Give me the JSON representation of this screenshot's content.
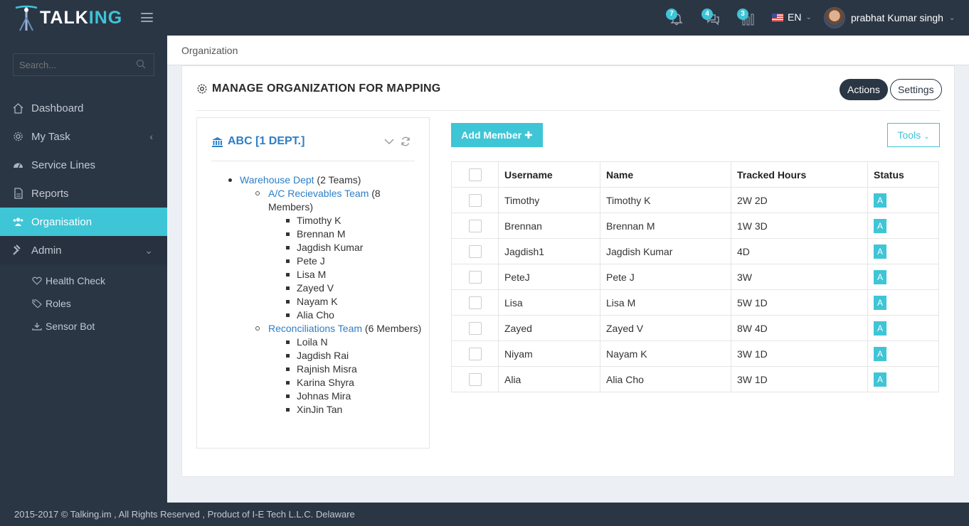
{
  "brand": {
    "logo_text_a": "TALK",
    "logo_text_b": "ING"
  },
  "topbar": {
    "notifications": {
      "count": "7",
      "icon": "bell-icon"
    },
    "messages": {
      "count": "4",
      "icon": "chat-icon"
    },
    "stats": {
      "count": "3",
      "icon": "bar-chart-icon"
    },
    "language": "EN",
    "user_name": "prabhat Kumar singh"
  },
  "sidebar": {
    "search_placeholder": "Search...",
    "items": [
      {
        "label": "Dashboard",
        "icon": "home-icon"
      },
      {
        "label": "My Task",
        "icon": "gear-icon"
      },
      {
        "label": "Service Lines",
        "icon": "gauge-icon"
      },
      {
        "label": "Reports",
        "icon": "document-icon"
      },
      {
        "label": "Organisation",
        "icon": "users-icon"
      },
      {
        "label": "Admin",
        "icon": "gavel-icon"
      }
    ],
    "admin_sub": [
      {
        "label": "Health Check",
        "icon": "heartbeat-icon"
      },
      {
        "label": "Roles",
        "icon": "tag-icon"
      },
      {
        "label": "Sensor Bot",
        "icon": "download-icon"
      }
    ]
  },
  "breadcrumb": "Organization",
  "panel": {
    "title": "MANAGE ORGANIZATION FOR MAPPING",
    "actions_label": "Actions",
    "settings_label": "Settings"
  },
  "tree": {
    "title": "ABC [1 DEPT.]",
    "dept": {
      "name": "Warehouse Dept",
      "suffix": " (2 Teams)"
    },
    "teams": [
      {
        "name": "A/C Recievables Team",
        "suffix": " (8 Members)",
        "members": [
          "Timothy K",
          "Brennan M",
          "Jagdish Kumar",
          "Pete J",
          "Lisa M",
          "Zayed V",
          "Nayam K",
          "Alia Cho"
        ]
      },
      {
        "name": "Reconciliations Team",
        "suffix": " (6 Members)",
        "members": [
          "Loila N",
          "Jagdish Rai",
          "Rajnish Misra",
          "Karina Shyra",
          "Johnas Mira",
          "XinJin Tan"
        ]
      }
    ]
  },
  "members_table": {
    "add_label": "Add Member",
    "tools_label": "Tools",
    "columns": [
      "Username",
      "Name",
      "Tracked Hours",
      "Status"
    ],
    "rows": [
      {
        "username": "Timothy",
        "name": "Timothy K",
        "hours": "2W 2D",
        "status": "A"
      },
      {
        "username": "Brennan",
        "name": "Brennan M",
        "hours": "1W 3D",
        "status": "A"
      },
      {
        "username": "Jagdish1",
        "name": "Jagdish Kumar",
        "hours": "4D",
        "status": "A"
      },
      {
        "username": "PeteJ",
        "name": "Pete J",
        "hours": "3W",
        "status": "A"
      },
      {
        "username": "Lisa",
        "name": "Lisa M",
        "hours": "5W 1D",
        "status": "A"
      },
      {
        "username": "Zayed",
        "name": "Zayed V",
        "hours": "8W 4D",
        "status": "A"
      },
      {
        "username": "Niyam",
        "name": "Nayam K",
        "hours": "3W 1D",
        "status": "A"
      },
      {
        "username": "Alia",
        "name": "Alia Cho",
        "hours": "3W 1D",
        "status": "A"
      }
    ]
  },
  "footer": "2015-2017 © Talking.im , All Rights Reserved , Product of I-E Tech L.L.C. Delaware",
  "colors": {
    "accent": "#3ec5d6",
    "dark": "#2b3645",
    "link": "#2d7ec6"
  }
}
